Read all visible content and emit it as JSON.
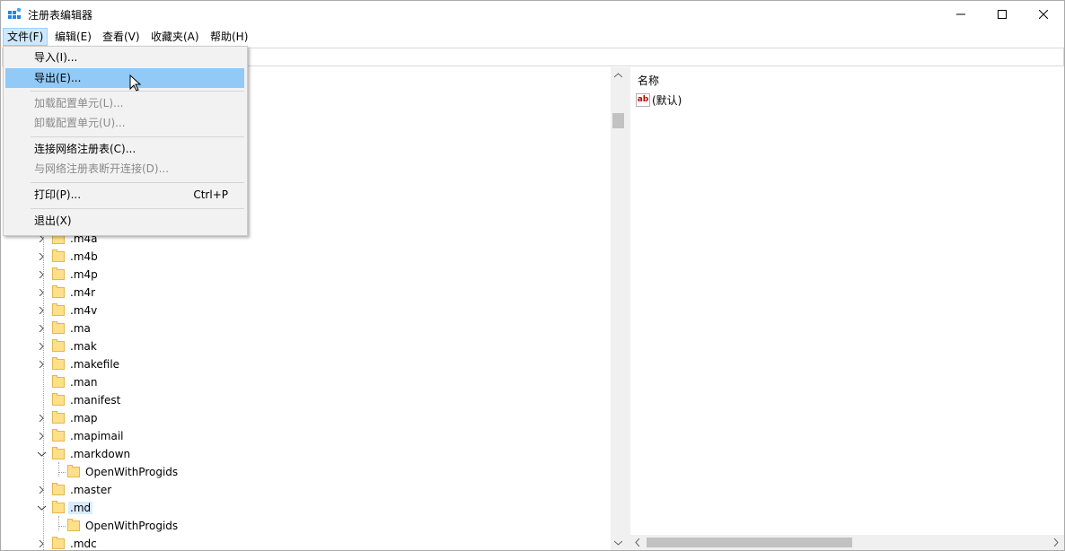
{
  "window": {
    "title": "注册表编辑器"
  },
  "menubar": [
    {
      "label": "文件(F)"
    },
    {
      "label": "编辑(E)"
    },
    {
      "label": "查看(V)"
    },
    {
      "label": "收藏夹(A)"
    },
    {
      "label": "帮助(H)"
    }
  ],
  "file_menu": {
    "items": [
      {
        "label": "导入(I)..."
      },
      {
        "label": "导出(E)..."
      },
      {
        "label": "加载配置单元(L)..."
      },
      {
        "label": "卸载配置单元(U)..."
      },
      {
        "label": "连接网络注册表(C)..."
      },
      {
        "label": "与网络注册表断开连接(D)..."
      },
      {
        "label": "打印(P)...",
        "shortcut": "Ctrl+P"
      },
      {
        "label": "退出(X)"
      }
    ]
  },
  "tree": {
    "rows": [
      {
        "label": ".m4a"
      },
      {
        "label": ".m4b"
      },
      {
        "label": ".m4p"
      },
      {
        "label": ".m4r"
      },
      {
        "label": ".m4v"
      },
      {
        "label": ".ma"
      },
      {
        "label": ".mak"
      },
      {
        "label": ".makefile"
      },
      {
        "label": ".man"
      },
      {
        "label": ".manifest"
      },
      {
        "label": ".map"
      },
      {
        "label": ".mapimail"
      },
      {
        "label": ".markdown"
      },
      {
        "label": "OpenWithProgids"
      },
      {
        "label": ".master"
      },
      {
        "label": ".md"
      },
      {
        "label": "OpenWithProgids"
      },
      {
        "label": ".mdc"
      }
    ]
  },
  "list": {
    "column_name": "名称",
    "values": [
      {
        "icon": "ab",
        "name": "(默认)"
      }
    ]
  },
  "colors": {
    "menu_hover": "#91c9f7",
    "selection": "#d9ecff",
    "folder": "#ffe08a"
  }
}
